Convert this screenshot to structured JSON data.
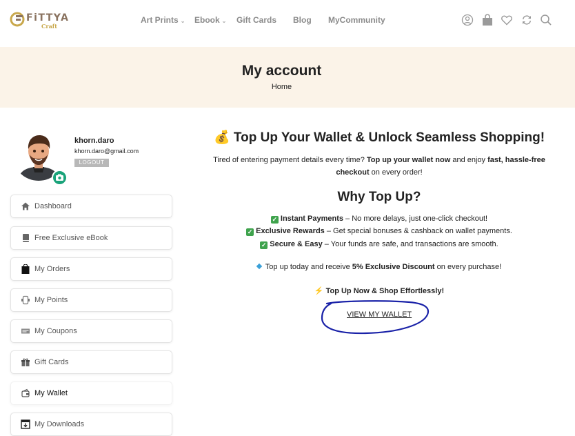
{
  "brand": {
    "name": "FiTTYA",
    "sub": "Craft"
  },
  "nav": [
    {
      "label": "Art Prints",
      "has_dropdown": true
    },
    {
      "label": "Ebook",
      "has_dropdown": true
    },
    {
      "label": "Gift Cards",
      "has_dropdown": false
    },
    {
      "label": "Blog",
      "has_dropdown": false
    },
    {
      "label": "MyCommunity",
      "has_dropdown": false
    }
  ],
  "header_icons": [
    "user-icon",
    "shopping-bag-icon",
    "heart-icon",
    "compare-icon",
    "search-icon"
  ],
  "banner": {
    "title": "My account",
    "breadcrumb": "Home"
  },
  "profile": {
    "username": "khorn.daro",
    "email": "khorn.daro@gmail.com",
    "logout_label": "LOGOUT"
  },
  "sidebar": {
    "items": [
      {
        "label": "Dashboard",
        "icon": "home-icon"
      },
      {
        "label": "Free Exclusive eBook",
        "icon": "book-icon"
      },
      {
        "label": "My Orders",
        "icon": "bag-icon"
      },
      {
        "label": "My Points",
        "icon": "points-icon"
      },
      {
        "label": "My Coupons",
        "icon": "coupon-icon"
      },
      {
        "label": "Gift Cards",
        "icon": "gift-icon"
      },
      {
        "label": "My Wallet",
        "icon": "wallet-icon",
        "active": true
      },
      {
        "label": "My Downloads",
        "icon": "download-icon"
      }
    ]
  },
  "content": {
    "headline_emoji": "💰",
    "headline": "Top Up Your Wallet & Unlock Seamless Shopping!",
    "intro_a": "Tired of entering payment details every time?",
    "intro_b": "Top up your wallet now",
    "intro_c": "and enjoy",
    "intro_d": "fast, hassle-free checkout",
    "intro_e": "on every order!",
    "why_title": "Why Top Up?",
    "benefits": [
      {
        "bold": "Instant Payments",
        "text": "– No more delays, just one-click checkout!"
      },
      {
        "bold": "Exclusive Rewards",
        "text": "– Get special bonuses & cashback on wallet payments."
      },
      {
        "bold": "Secure & Easy",
        "text": "– Your funds are safe, and transactions are smooth."
      }
    ],
    "promo_a": "Top up today and receive",
    "promo_b": "5% Exclusive Discount",
    "promo_c": "on every purchase!",
    "cta_text": "Top Up Now & Shop Effortlessly!",
    "wallet_link": "VIEW MY WALLET"
  },
  "colors": {
    "banner_bg": "#fbf3e8",
    "annotation": "#1a22a8",
    "camera_badge": "#1aa37a",
    "logout_bg": "#b8b8b8"
  }
}
